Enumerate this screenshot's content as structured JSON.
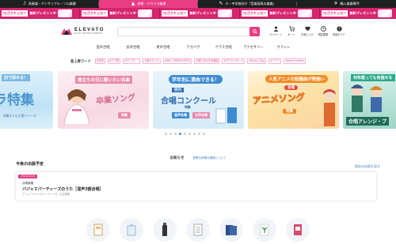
{
  "topbar": {
    "tabs": [
      {
        "label": "吹奏楽・アンサンブル・ソロ楽譜",
        "icon": "instrument-icon",
        "active": false
      },
      {
        "label": "合唱・アカペラ楽譜",
        "icon": "chorus-logo-icon",
        "active": true
      },
      {
        "label": "小・中学校向け「音楽発表の楽譜」",
        "icon": "school-icon",
        "active": false
      },
      {
        "label": "輸入楽譜専門",
        "icon": "import-icon",
        "active": false
      },
      {
        "label": "",
        "icon": "",
        "active": false
      }
    ]
  },
  "promo": {
    "items": [
      {
        "tag": "ロゴステッカー",
        "text": "無料プレゼント中"
      },
      {
        "tag": "ロゴステッカー",
        "text": "無料プレゼント中"
      },
      {
        "tag": "ロゴステッカー",
        "text": "無料プレゼント中"
      },
      {
        "tag": "ロゴステッカー",
        "text": "無料プレゼント中"
      },
      {
        "tag": "ロゴステッカー",
        "text": "無料プレゼント中"
      }
    ],
    "color": "#d6246e"
  },
  "header": {
    "logo_text": "ELEVATO",
    "logo_sub": "MUSIC ENTERTAINMENT",
    "search_placeholder": "",
    "icons": [
      {
        "name": "mypage",
        "label": "マイページ",
        "icon": "user-icon"
      },
      {
        "name": "cart",
        "label": "カート",
        "icon": "cart-icon"
      },
      {
        "name": "favorites",
        "label": "お気に入り",
        "icon": "heart-icon"
      },
      {
        "name": "history",
        "label": "閲覧履歴",
        "icon": "clock-icon"
      },
      {
        "name": "guide",
        "label": "利用ガイド",
        "icon": "question-icon"
      }
    ]
  },
  "nav": {
    "items": [
      "混声合唱",
      "女声合唱",
      "男声合唱",
      "アカペラ",
      "クラス合唱",
      "アクセサリー",
      "ウクレレ"
    ]
  },
  "popular": {
    "label": "急上昇ワード",
    "tags": [
      "#信長",
      "#アナ雪",
      "#ディズニー",
      "#嵐ももいろ",
      "#Mrs. GREEN APPLE",
      "#君に伝わる合唱曲",
      "#マツケンサンバ",
      "#Saucy Dog",
      "#ジブリ",
      "#back number"
    ]
  },
  "carousel": {
    "slides": [
      {
        "caption": "ラ特集",
        "sub": "卒業テレビ小説シリーズ",
        "top": "別で探せる！"
      },
      {
        "caption": "卒業ソング",
        "top": "旅立ちの日に歌いたい名曲",
        "sub": "特集"
      },
      {
        "caption": "合唱コンクール",
        "top": "学年別に選曲できる！",
        "sub": "特集",
        "badge1": "混声合唱",
        "badge2": "女声合唱",
        "badge3": "校内"
      },
      {
        "caption": "アニメソング",
        "top": "人気アニメの話題曲が勢揃い",
        "sub": "特集",
        "badge1": "合唱"
      },
      {
        "caption": "合唱アレンジ",
        "top": "何年経っても色褪せな",
        "sub": "合唱アレンジ・プ"
      }
    ],
    "dots": 9,
    "active_dot": 3,
    "accent": "#3b9ad9"
  },
  "notice": {
    "title": "お知らせ",
    "link": "営業日休業日確認について"
  },
  "schedule": {
    "heading": "今後の出版予定",
    "more_link": "過去の出版を見る",
    "items": [
      {
        "date": "2024/1/20",
        "category": "合唱楽譜",
        "title": "バジャマパーティーズのうた［混声3部合唱］",
        "sub": "アニメ「パジャマパーティーズ」の主題歌"
      }
    ]
  },
  "thumbs": [
    {
      "name": "product-1",
      "icon": "book-icon"
    },
    {
      "name": "product-2",
      "icon": "bag-icon"
    },
    {
      "name": "product-3",
      "icon": "bottle-icon"
    },
    {
      "name": "product-4",
      "icon": "note-icon"
    },
    {
      "name": "product-5",
      "icon": "clipboard-icon"
    },
    {
      "name": "product-6",
      "icon": "plant-book-icon"
    },
    {
      "name": "product-7",
      "icon": "card-icon"
    }
  ],
  "colors": {
    "brand_pink": "#e83c83",
    "link_blue": "#3b7fc4",
    "topbar_dark": "#1f1f1f"
  }
}
